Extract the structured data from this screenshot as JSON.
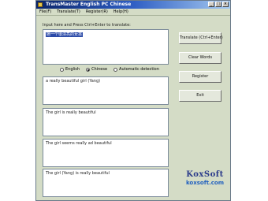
{
  "window": {
    "title": "TransMaster English PC Chinese"
  },
  "menu": [
    "File(F)",
    "Translate(T)",
    "Register(R)",
    "Help(H)"
  ],
  "input_label": "Input here and Press Ctrl+Enter to translate:",
  "input_text": "她一个很漂亮的女孩",
  "radio_options": [
    {
      "label": "English",
      "selected": false
    },
    {
      "label": "Chinese",
      "selected": true
    },
    {
      "label": "Automatic detection",
      "selected": false
    }
  ],
  "outputs": [
    "a really beautiful girl (Yang)",
    "The girl is really beautiful",
    "The girl seems really ad beautiful",
    "The girl (Yang) is really beautiful"
  ],
  "buttons": [
    "Translate (Ctrl+Enter)",
    "Clear Words",
    "Register",
    "Exit"
  ],
  "logo": {
    "brand": "KoxSoft",
    "domain": "koxsoft.com"
  }
}
